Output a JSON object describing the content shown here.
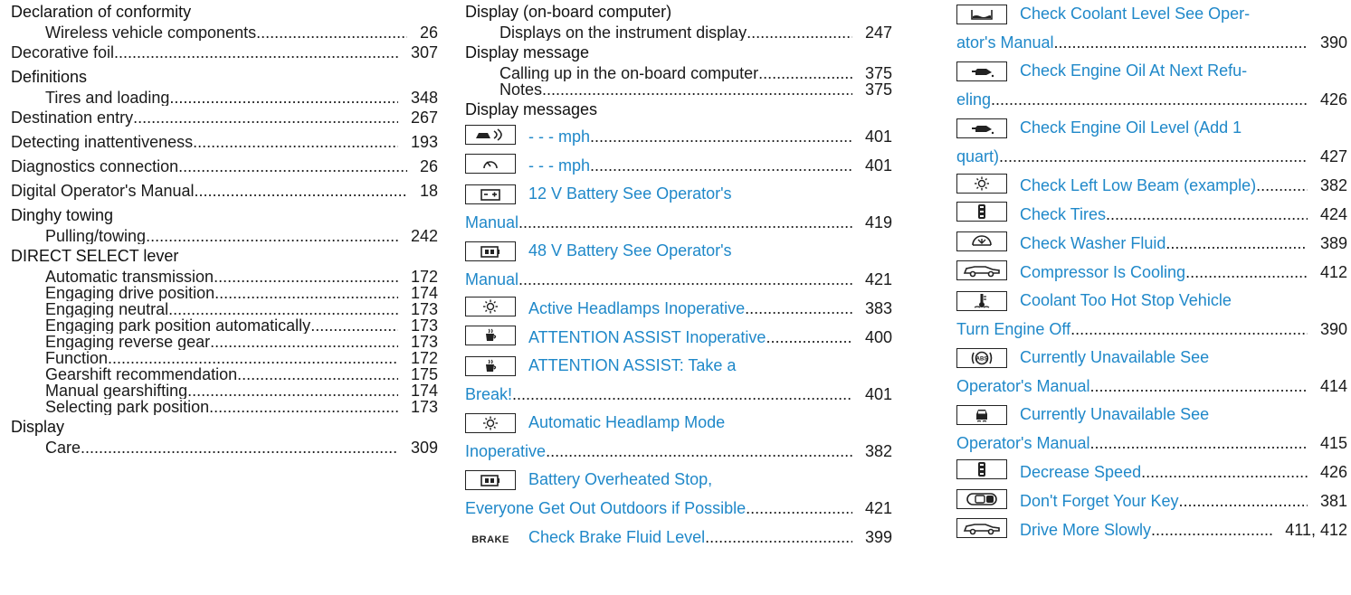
{
  "col1": [
    {
      "kind": "head",
      "label": "Declaration of conformity"
    },
    {
      "kind": "sub",
      "label": "Wireless vehicle components",
      "page": "26"
    },
    {
      "kind": "headline",
      "label": "Decorative foil",
      "page": "307"
    },
    {
      "kind": "head",
      "label": "Definitions"
    },
    {
      "kind": "sub",
      "label": "Tires and loading",
      "page": "348"
    },
    {
      "kind": "headline",
      "label": "Destination entry",
      "page": "267"
    },
    {
      "kind": "headline",
      "label": "Detecting inattentiveness",
      "page": "193"
    },
    {
      "kind": "headline",
      "label": "Diagnostics connection",
      "page": "26"
    },
    {
      "kind": "headline",
      "label": "Digital Operator's Manual",
      "page": "18"
    },
    {
      "kind": "head",
      "label": "Dinghy towing"
    },
    {
      "kind": "sub",
      "label": "Pulling/towing",
      "page": "242"
    },
    {
      "kind": "head",
      "label": "DIRECT SELECT lever"
    },
    {
      "kind": "sub",
      "label": "Automatic transmission",
      "page": "172"
    },
    {
      "kind": "sub",
      "label": "Engaging drive position",
      "page": "174"
    },
    {
      "kind": "sub",
      "label": "Engaging neutral",
      "page": "173"
    },
    {
      "kind": "sub",
      "label": "Engaging park position automatically",
      "page": "173"
    },
    {
      "kind": "sub",
      "label": "Engaging reverse gear",
      "page": "173"
    },
    {
      "kind": "sub",
      "label": "Function",
      "page": "172"
    },
    {
      "kind": "sub",
      "label": "Gearshift recommendation",
      "page": "175"
    },
    {
      "kind": "sub",
      "label": "Manual gearshifting",
      "page": "174"
    },
    {
      "kind": "sub",
      "label": "Selecting park position",
      "page": "173"
    },
    {
      "kind": "head",
      "label": "Display"
    },
    {
      "kind": "sub",
      "label": "Care",
      "page": "309"
    }
  ],
  "col2": [
    {
      "kind": "head",
      "label": "Display (on-board computer)"
    },
    {
      "kind": "sub",
      "label": "Displays on the instrument display",
      "page": "247"
    },
    {
      "kind": "head",
      "label": "Display message"
    },
    {
      "kind": "sub",
      "label": "Calling up in the on-board computer",
      "page": "375"
    },
    {
      "kind": "sub",
      "label": "Notes",
      "page": "375"
    },
    {
      "kind": "head",
      "label": "Display messages"
    },
    {
      "kind": "msg",
      "icon": "car-distance-icon",
      "label": "- - - mph",
      "page": "401"
    },
    {
      "kind": "msg",
      "icon": "speedometer-icon",
      "label": "- - - mph",
      "page": "401"
    },
    {
      "kind": "msgtop",
      "icon": "battery-icon",
      "label": "12 V Battery See Operator's"
    },
    {
      "kind": "cont",
      "label": "Manual",
      "page": "419"
    },
    {
      "kind": "msgtop",
      "icon": "battery-48v-icon",
      "label": "48 V Battery See Operator's"
    },
    {
      "kind": "cont",
      "label": "Manual",
      "page": "421"
    },
    {
      "kind": "msg",
      "icon": "headlamp-icon",
      "label": "Active Headlamps Inoperative",
      "page": "383"
    },
    {
      "kind": "msg",
      "icon": "coffee-cup-icon",
      "label": "ATTENTION ASSIST Inoperative",
      "page": "400"
    },
    {
      "kind": "msgtop",
      "icon": "coffee-cup-icon",
      "label": "ATTENTION ASSIST: Take a"
    },
    {
      "kind": "cont",
      "label": "Break!",
      "page": "401"
    },
    {
      "kind": "msgtop",
      "icon": "headlamp-icon",
      "label": "Automatic Headlamp Mode"
    },
    {
      "kind": "cont",
      "label": "Inoperative",
      "page": "382"
    },
    {
      "kind": "msgtop",
      "icon": "battery-48v-icon",
      "label": "Battery Overheated Stop,"
    },
    {
      "kind": "cont",
      "label": "Everyone Get Out Outdoors if Possible",
      "page": "421"
    },
    {
      "kind": "msg",
      "icon": "brake-icon",
      "iconText": "BRAKE",
      "label": "Check Brake Fluid Level",
      "page": "399"
    }
  ],
  "col3": [
    {
      "kind": "msgtop",
      "icon": "coolant-level-icon",
      "label": "Check Coolant Level See Oper-"
    },
    {
      "kind": "cont",
      "label": "ator's Manual",
      "page": "390"
    },
    {
      "kind": "msgtop",
      "icon": "oil-can-icon",
      "label": "Check Engine Oil At Next Refu-"
    },
    {
      "kind": "cont",
      "label": "eling",
      "page": "426"
    },
    {
      "kind": "msgtop",
      "icon": "oil-can-icon",
      "label": "Check Engine Oil Level (Add 1"
    },
    {
      "kind": "cont",
      "label": "quart)",
      "page": "427"
    },
    {
      "kind": "msg",
      "icon": "headlamp-icon",
      "label": "Check Left Low Beam (example)",
      "page": "382"
    },
    {
      "kind": "msg",
      "icon": "tire-icon",
      "label": "Check Tires",
      "page": "424"
    },
    {
      "kind": "msg",
      "icon": "washer-fluid-icon",
      "label": "Check Washer Fluid",
      "page": "389"
    },
    {
      "kind": "msg",
      "icon": "car-side-icon",
      "label": "Compressor Is Cooling",
      "page": "412"
    },
    {
      "kind": "msgtop",
      "icon": "coolant-temp-icon",
      "label": "Coolant Too Hot Stop Vehicle"
    },
    {
      "kind": "cont",
      "label": "Turn Engine Off",
      "page": "390"
    },
    {
      "kind": "msgtop",
      "icon": "abs-icon",
      "label": "Currently Unavailable See"
    },
    {
      "kind": "cont",
      "label": "Operator's Manual",
      "page": "414"
    },
    {
      "kind": "msgtop",
      "icon": "car-front-icon",
      "label": "Currently Unavailable See"
    },
    {
      "kind": "cont",
      "label": "Operator's Manual",
      "page": "415"
    },
    {
      "kind": "msg",
      "icon": "tire-icon",
      "label": "Decrease Speed",
      "page": "426"
    },
    {
      "kind": "msg",
      "icon": "key-icon",
      "label": "Don't Forget Your Key",
      "page": "381"
    },
    {
      "kind": "msg",
      "icon": "car-side-icon",
      "label": "Drive More Slowly",
      "page": "411, 412"
    }
  ],
  "colors": {
    "link": "#1f88c9",
    "text": "#1a1a1a"
  }
}
